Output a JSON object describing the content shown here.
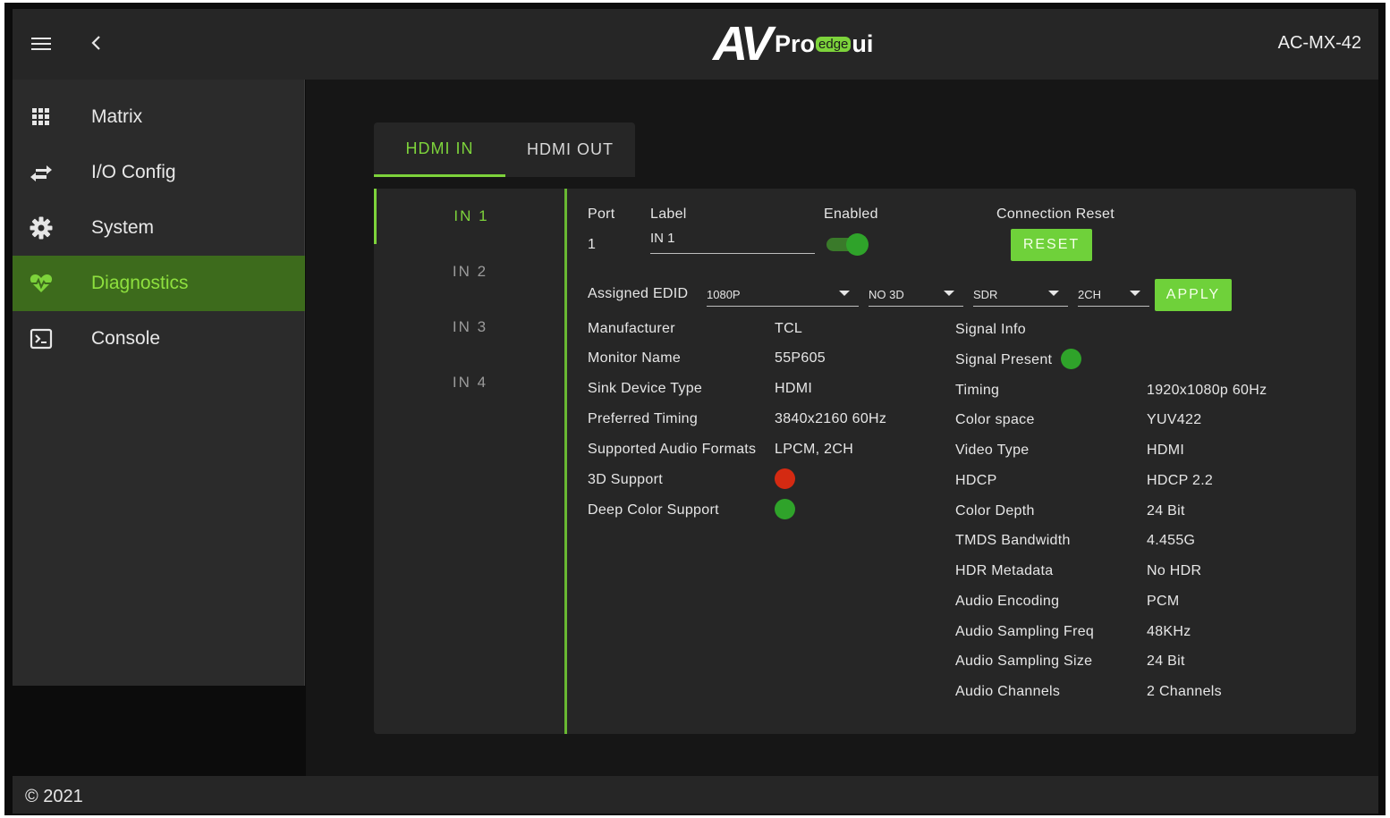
{
  "header": {
    "logo_av": "AV",
    "logo_pro": "Pro",
    "logo_edge": "edge",
    "logo_ui": "ui",
    "model": "AC-MX-42"
  },
  "sidebar": {
    "items": [
      {
        "label": "Matrix",
        "icon": "grid-icon",
        "active": false
      },
      {
        "label": "I/O Config",
        "icon": "swap-arrows-icon",
        "active": false
      },
      {
        "label": "System",
        "icon": "gear-icon",
        "active": false
      },
      {
        "label": "Diagnostics",
        "icon": "heartbeat-icon",
        "active": true
      },
      {
        "label": "Console",
        "icon": "terminal-icon",
        "active": false
      }
    ]
  },
  "tabs": [
    {
      "label": "HDMI IN",
      "active": true
    },
    {
      "label": "HDMI OUT",
      "active": false
    }
  ],
  "inputs": [
    {
      "label": "IN 1",
      "active": true
    },
    {
      "label": "IN 2",
      "active": false
    },
    {
      "label": "IN 3",
      "active": false
    },
    {
      "label": "IN 4",
      "active": false
    }
  ],
  "port_section": {
    "port_heading": "Port",
    "port_value": "1",
    "label_heading": "Label",
    "label_value": "IN 1",
    "enabled_heading": "Enabled",
    "enabled": true,
    "connection_reset_heading": "Connection Reset",
    "reset_label": "RESET"
  },
  "edid": {
    "heading": "Assigned EDID",
    "resolution": "1080P",
    "three_d": "NO 3D",
    "dynamic_range": "SDR",
    "audio": "2CH",
    "apply_label": "APPLY"
  },
  "monitor_info": [
    {
      "label": "Manufacturer",
      "value": "TCL"
    },
    {
      "label": "Monitor Name",
      "value": "55P605"
    },
    {
      "label": "Sink Device Type",
      "value": "HDMI"
    },
    {
      "label": "Preferred Timing",
      "value": "3840x2160 60Hz"
    },
    {
      "label": "Supported Audio Formats",
      "value": "LPCM, 2CH"
    },
    {
      "label": "3D Support",
      "status": "no"
    },
    {
      "label": "Deep Color Support",
      "status": "yes"
    }
  ],
  "signal_info": {
    "heading": "Signal Info",
    "present_label": "Signal Present",
    "present": true,
    "rows": [
      {
        "label": "Timing",
        "value": "1920x1080p 60Hz"
      },
      {
        "label": "Color space",
        "value": "YUV422"
      },
      {
        "label": "Video Type",
        "value": "HDMI"
      },
      {
        "label": "HDCP",
        "value": "HDCP 2.2"
      },
      {
        "label": "Color Depth",
        "value": "24 Bit"
      },
      {
        "label": "TMDS Bandwidth",
        "value": "4.455G"
      },
      {
        "label": "HDR Metadata",
        "value": "No HDR"
      },
      {
        "label": "Audio Encoding",
        "value": "PCM"
      },
      {
        "label": "Audio Sampling Freq",
        "value": "48KHz"
      },
      {
        "label": "Audio Sampling Size",
        "value": "24 Bit"
      },
      {
        "label": "Audio Channels",
        "value": "2 Channels"
      }
    ]
  },
  "colors": {
    "accent": "#7dd33b",
    "active_nav_bg": "#3d6b1c",
    "status_ok": "#2fa32a",
    "status_bad": "#d42a12"
  },
  "footer": {
    "copyright": "© 2021"
  }
}
